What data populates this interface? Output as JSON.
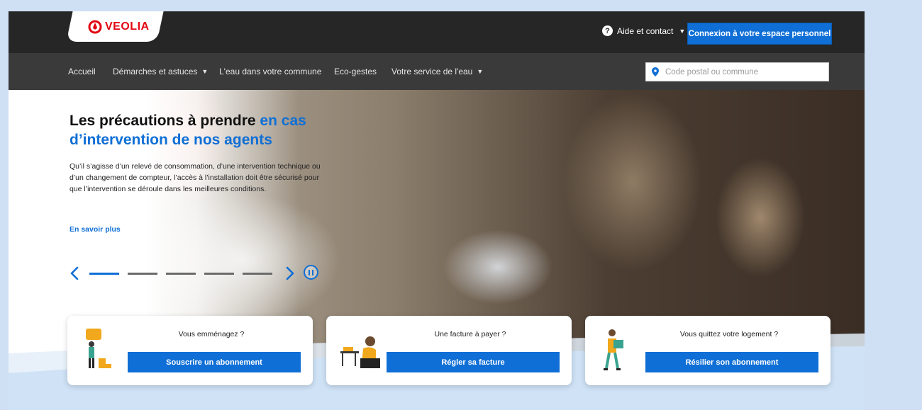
{
  "header": {
    "brand": "VEOLIA",
    "help_label": "Aide et contact",
    "login_label": "Connexion à votre espace personnel"
  },
  "nav": {
    "items": [
      {
        "label": "Accueil",
        "dropdown": false
      },
      {
        "label": "Démarches et astuces",
        "dropdown": true
      },
      {
        "label": "L'eau dans votre commune",
        "dropdown": false
      },
      {
        "label": "Eco-gestes",
        "dropdown": false
      },
      {
        "label": "Votre service de l'eau",
        "dropdown": true
      }
    ],
    "search_placeholder": "Code postal ou commune"
  },
  "hero": {
    "title_part1": "Les précautions à prendre ",
    "title_accent": "en cas d’intervention de nos agents",
    "description": "Qu’il s’agisse d’un relevé de consommation, d’une intervention technique ou d’un changement de compteur, l’accès à l’installation doit être sécurisé pour que l’intervention se déroule dans les meilleures conditions.",
    "link_label": "En savoir plus",
    "slides_total": 5,
    "slide_active": 1
  },
  "cards": [
    {
      "title": "Vous emménagez ?",
      "button": "Souscrire un abonnement",
      "illustration": "moving-in-person-icon"
    },
    {
      "title": "Une facture à payer ?",
      "button": "Régler sa facture",
      "illustration": "person-at-desk-icon"
    },
    {
      "title": "Vous quittez votre logement ?",
      "button": "Résilier son abonnement",
      "illustration": "person-carrying-box-icon"
    }
  ],
  "colors": {
    "accent": "#0f6fd6",
    "brand_red": "#e30613",
    "topbar": "#262626",
    "navbar": "#3a3a3a",
    "outer_bg": "#cfe0f4"
  }
}
